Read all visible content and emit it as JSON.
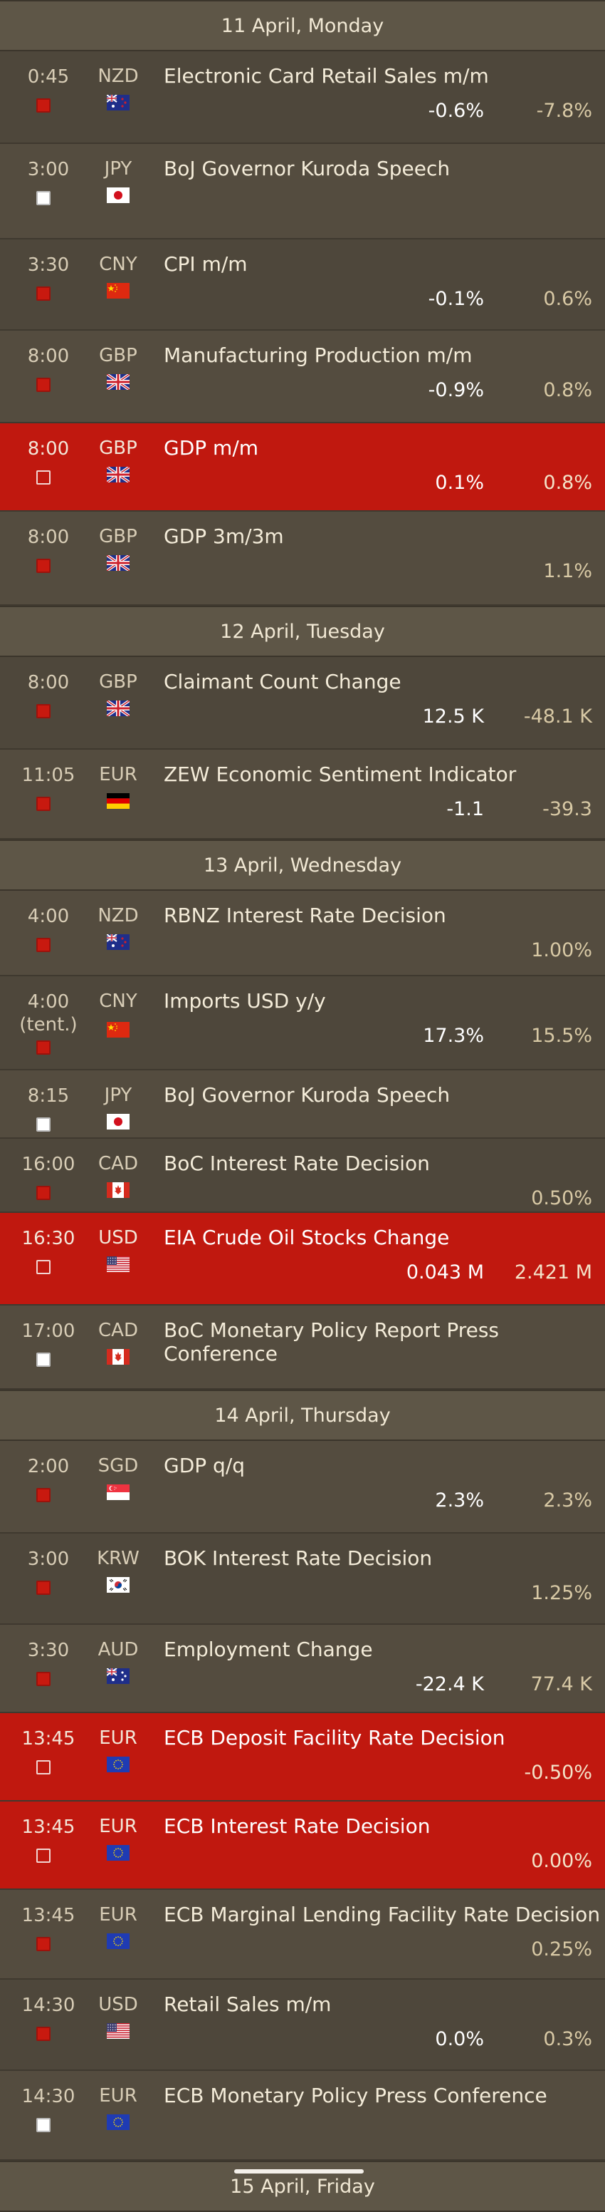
{
  "days": [
    {
      "label": "11 April, Monday",
      "events": [
        {
          "time": "0:45",
          "currency": "NZD",
          "flag": "nz-flag-icon",
          "title": "Electronic Card Retail Sales m/m",
          "actual": "-0.6%",
          "previous": "-7.8%",
          "importance": "high",
          "highlight": false
        },
        {
          "time": "3:00",
          "currency": "JPY",
          "flag": "jp-flag-icon",
          "title": "BoJ Governor Kuroda Speech",
          "actual": "",
          "previous": "",
          "importance": "low",
          "highlight": false
        },
        {
          "time": "3:30",
          "currency": "CNY",
          "flag": "cn-flag-icon",
          "title": "CPI m/m",
          "actual": "-0.1%",
          "previous": "0.6%",
          "importance": "high",
          "highlight": false
        },
        {
          "time": "8:00",
          "currency": "GBP",
          "flag": "gb-flag-icon",
          "title": "Manufacturing Production m/m",
          "actual": "-0.9%",
          "previous": "0.8%",
          "importance": "high",
          "highlight": false
        },
        {
          "time": "8:00",
          "currency": "GBP",
          "flag": "gb-flag-icon",
          "title": "GDP m/m",
          "actual": "0.1%",
          "previous": "0.8%",
          "importance": "low",
          "highlight": true
        },
        {
          "time": "8:00",
          "currency": "GBP",
          "flag": "gb-flag-icon",
          "title": "GDP 3m/3m",
          "actual": "",
          "previous": "1.1%",
          "importance": "high",
          "highlight": false
        }
      ]
    },
    {
      "label": "12 April, Tuesday",
      "events": [
        {
          "time": "8:00",
          "currency": "GBP",
          "flag": "gb-flag-icon",
          "title": "Claimant Count Change",
          "actual": "12.5 K",
          "previous": "-48.1 K",
          "importance": "high",
          "highlight": false
        },
        {
          "time": "11:05",
          "currency": "EUR",
          "flag": "de-flag-icon",
          "title": "ZEW Economic Sentiment Indicator",
          "actual": "-1.1",
          "previous": "-39.3",
          "importance": "high",
          "highlight": false
        }
      ]
    },
    {
      "label": "13 April, Wednesday",
      "events": [
        {
          "time": "4:00",
          "currency": "NZD",
          "flag": "nz-flag-icon",
          "title": "RBNZ Interest Rate Decision",
          "actual": "",
          "previous": "1.00%",
          "importance": "high",
          "highlight": false
        },
        {
          "time": "4:00\n(tent.)",
          "currency": "CNY",
          "flag": "cn-flag-icon",
          "title": "Imports USD y/y",
          "actual": "17.3%",
          "previous": "15.5%",
          "importance": "high",
          "highlight": false
        },
        {
          "time": "8:15",
          "currency": "JPY",
          "flag": "jp-flag-icon",
          "title": "BoJ Governor Kuroda Speech",
          "actual": "",
          "previous": "",
          "importance": "low",
          "highlight": false
        },
        {
          "time": "16:00",
          "currency": "CAD",
          "flag": "ca-flag-icon",
          "title": "BoC Interest Rate Decision",
          "actual": "",
          "previous": "0.50%",
          "importance": "high",
          "highlight": false
        },
        {
          "time": "16:30",
          "currency": "USD",
          "flag": "us-flag-icon",
          "title": "EIA Crude Oil Stocks Change",
          "actual": "0.043 M",
          "previous": "2.421 M",
          "importance": "low",
          "highlight": true
        },
        {
          "time": "17:00",
          "currency": "CAD",
          "flag": "ca-flag-icon",
          "title": "BoC Monetary Policy Report Press Conference",
          "actual": "",
          "previous": "",
          "importance": "low",
          "highlight": false
        }
      ]
    },
    {
      "label": "14 April, Thursday",
      "events": [
        {
          "time": "2:00",
          "currency": "SGD",
          "flag": "sg-flag-icon",
          "title": "GDP q/q",
          "actual": "2.3%",
          "previous": "2.3%",
          "importance": "high",
          "highlight": false
        },
        {
          "time": "3:00",
          "currency": "KRW",
          "flag": "kr-flag-icon",
          "title": "BOK Interest Rate Decision",
          "actual": "",
          "previous": "1.25%",
          "importance": "high",
          "highlight": false
        },
        {
          "time": "3:30",
          "currency": "AUD",
          "flag": "au-flag-icon",
          "title": "Employment Change",
          "actual": "-22.4 K",
          "previous": "77.4 K",
          "importance": "high",
          "highlight": false
        },
        {
          "time": "13:45",
          "currency": "EUR",
          "flag": "eu-flag-icon",
          "title": "ECB Deposit Facility Rate Decision",
          "actual": "",
          "previous": "-0.50%",
          "importance": "low",
          "highlight": true
        },
        {
          "time": "13:45",
          "currency": "EUR",
          "flag": "eu-flag-icon",
          "title": "ECB Interest Rate Decision",
          "actual": "",
          "previous": "0.00%",
          "importance": "low",
          "highlight": true
        },
        {
          "time": "13:45",
          "currency": "EUR",
          "flag": "eu-flag-icon",
          "title": "ECB Marginal Lending Facility Rate Decision",
          "actual": "",
          "previous": "0.25%",
          "importance": "high",
          "highlight": false
        },
        {
          "time": "14:30",
          "currency": "USD",
          "flag": "us-flag-icon",
          "title": "Retail Sales m/m",
          "actual": "0.0%",
          "previous": "0.3%",
          "importance": "high",
          "highlight": false
        },
        {
          "time": "14:30",
          "currency": "EUR",
          "flag": "eu-flag-icon",
          "title": "ECB Monetary Policy Press Conference",
          "actual": "",
          "previous": "",
          "importance": "low",
          "highlight": false
        }
      ]
    },
    {
      "label": "15 April, Friday",
      "events": []
    }
  ],
  "colors": {
    "background": "#4e473b",
    "day_header": "#5e5647",
    "highlight": "#c0180f",
    "high_importance": "#c8190f"
  }
}
